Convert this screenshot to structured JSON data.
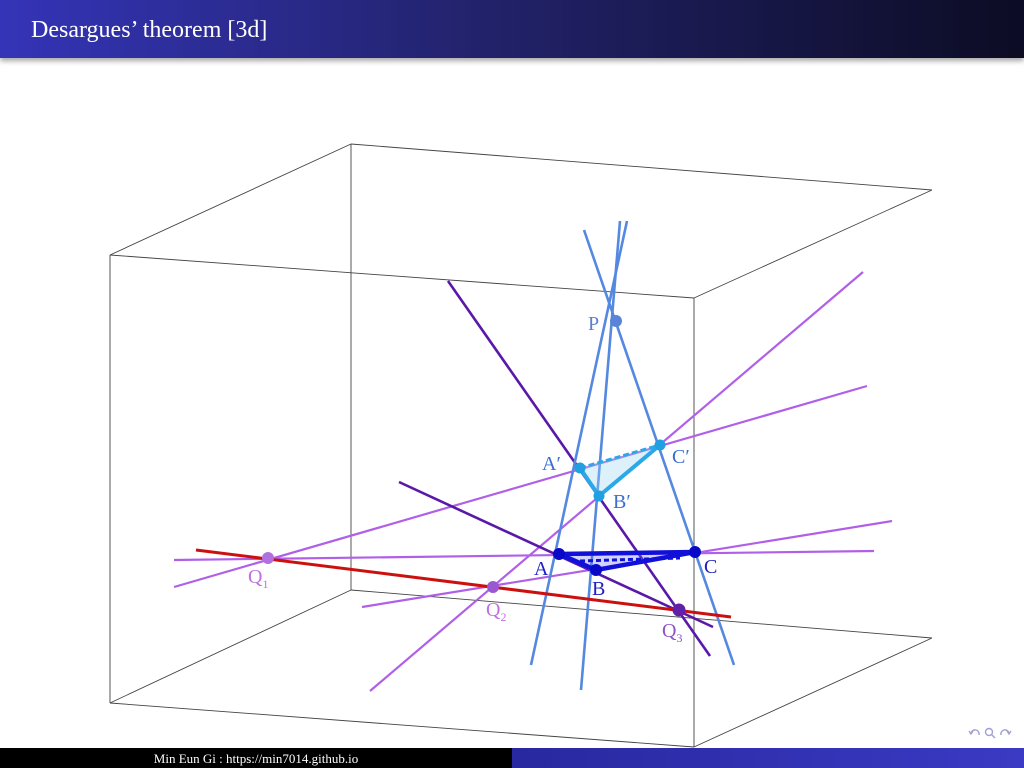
{
  "header": {
    "title": "Desargues’ theorem [3d]"
  },
  "figure": {
    "points": {
      "P": "P",
      "A_prime": "A′",
      "B_prime": "B′",
      "C_prime": "C′",
      "A": "A",
      "B": "B",
      "C": "C",
      "Q1_main": "Q",
      "Q1_sub": "1",
      "Q2_main": "Q",
      "Q2_sub": "2",
      "Q3_main": "Q",
      "Q3_sub": "3"
    },
    "colors": {
      "projection_lines": "#5588e0",
      "triangle_prime": "#2aa8e8",
      "triangle_base": "#1010d8",
      "side_lines_dark": "#5a18a8",
      "side_lines_light": "#b060e8",
      "desargues_axis": "#cc1010",
      "box": "#444444",
      "point_label": "#5a7fd0",
      "q_label": "#c070e0"
    }
  },
  "footer": {
    "text": "Min Eun Gi : https://min7014.github.io"
  }
}
